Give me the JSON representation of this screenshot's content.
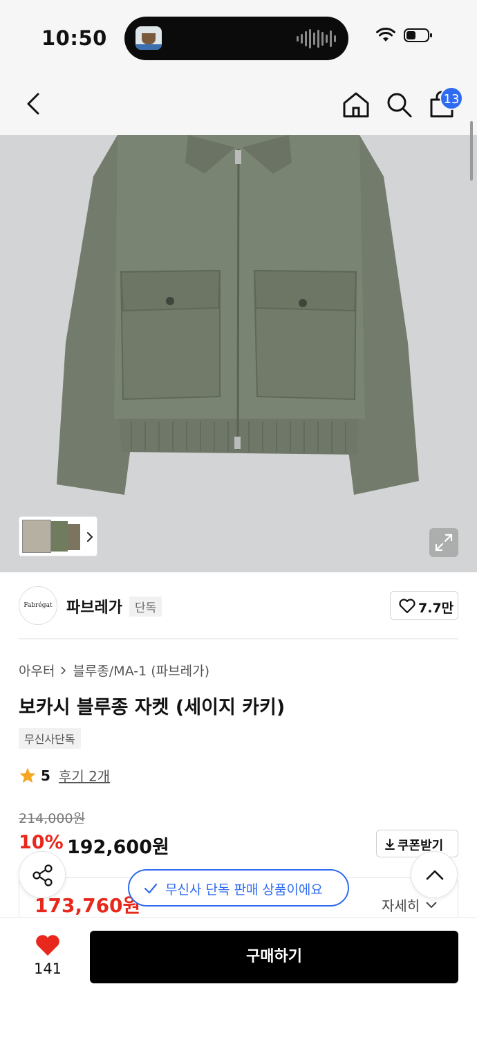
{
  "status_bar": {
    "time": "10:50"
  },
  "nav": {
    "cart_count": "13"
  },
  "brand": {
    "logo_text": "Fabrégat",
    "name": "파브레가",
    "tag": "단독",
    "likes": "7.7만"
  },
  "product": {
    "breadcrumb": [
      "아우터",
      "블루종/MA-1 (파브레가)"
    ],
    "title": "보카시 블루종 자켓 (세이지 카키)",
    "exclusive_tag": "무신사단독",
    "rating": "5",
    "reviews": "후기 2개"
  },
  "pricing": {
    "original": "214,000원",
    "discount": "10%",
    "price": "192,600원",
    "coupon_label": "쿠폰받기",
    "benefit_price": "173,760원",
    "detail_label": "자세히"
  },
  "notice": {
    "text": "무신사 단독 판매 상품이에요"
  },
  "bottom": {
    "like_count": "141",
    "buy_label": "구매하기"
  },
  "colors": {
    "accent_blue": "#2e6bf0",
    "sale_red": "#e8281c",
    "jacket": "#7a8472"
  }
}
